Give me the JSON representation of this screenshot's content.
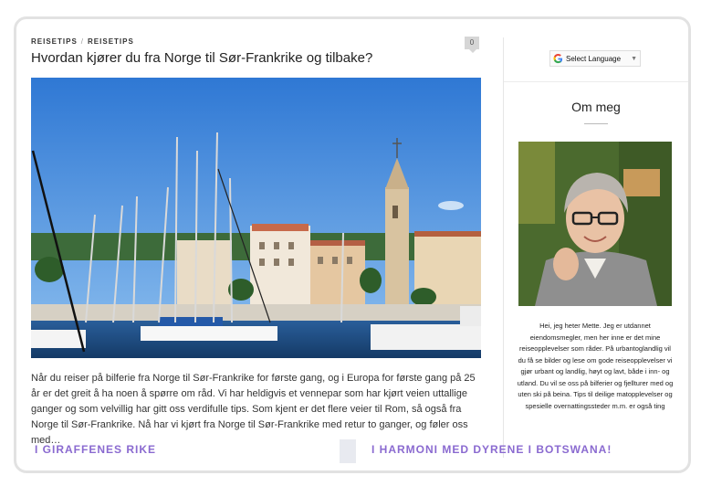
{
  "post": {
    "categories": [
      "REISETIPS",
      "REISETIPS"
    ],
    "category_separator": "/",
    "title": "Hvordan kjører du fra Norge til Sør-Frankrike og tilbake?",
    "comment_count": "0",
    "excerpt": "Når du reiser på bilferie fra Norge til Sør-Frankrike for første gang, og i Europa for første gang på 25 år er det greit å ha noen å spørre om råd. Vi har heldigvis et vennepar som har kjørt veien uttallige ganger og som velvillig har gitt oss verdifulle tips. Som kjent er det flere veier til Rom, så også fra Norge til Sør-Frankrike. Nå har vi kjørt fra Norge til Sør-Frankrike med retur to ganger, og føler oss med…"
  },
  "sidebar": {
    "translate_label": "Select Language",
    "about_title": "Om meg",
    "bio": "Hei, jeg heter Mette. Jeg er utdannet eiendomsmegler, men her inne er det mine reiseopplevelser som råder. På urbantoglandlig vil du få se bilder og lese om gode reiseopplevelser vi gjør urbant og landlig, høyt og lavt, både i inn- og utland. Du vil se oss på bilferier og fjellturer med og uten ski på beina. Tips til deilige matopplevelser og spesielle overnattingssteder m.m. er også ting"
  },
  "footer": {
    "prev_link": "I GIRAFFENES RIKE",
    "next_link": "I HARMONI MED DYRENE I BOTSWANA!"
  },
  "colors": {
    "accent": "#8a6ad0",
    "sky": "#4a8fdc"
  }
}
